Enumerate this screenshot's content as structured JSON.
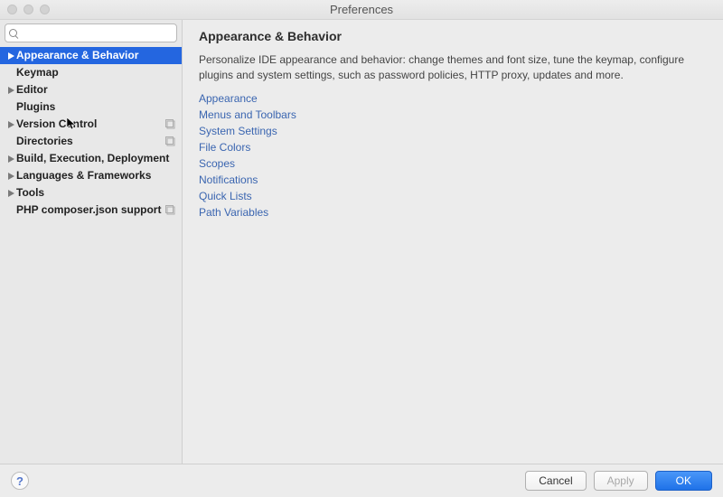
{
  "window": {
    "title": "Preferences"
  },
  "search": {
    "placeholder": ""
  },
  "sidebar": {
    "items": [
      {
        "label": "Appearance & Behavior",
        "expandable": true,
        "bold": true,
        "selected": true,
        "indent": 0,
        "projMarker": false
      },
      {
        "label": "Keymap",
        "expandable": false,
        "bold": true,
        "selected": false,
        "indent": 0,
        "projMarker": false
      },
      {
        "label": "Editor",
        "expandable": true,
        "bold": true,
        "selected": false,
        "indent": 0,
        "projMarker": false
      },
      {
        "label": "Plugins",
        "expandable": false,
        "bold": true,
        "selected": false,
        "indent": 0,
        "projMarker": false
      },
      {
        "label": "Version Control",
        "expandable": true,
        "bold": true,
        "selected": false,
        "indent": 0,
        "projMarker": true,
        "cursor": true
      },
      {
        "label": "Directories",
        "expandable": false,
        "bold": true,
        "selected": false,
        "indent": 0,
        "projMarker": true
      },
      {
        "label": "Build, Execution, Deployment",
        "expandable": true,
        "bold": true,
        "selected": false,
        "indent": 0,
        "projMarker": false
      },
      {
        "label": "Languages & Frameworks",
        "expandable": true,
        "bold": true,
        "selected": false,
        "indent": 0,
        "projMarker": false
      },
      {
        "label": "Tools",
        "expandable": true,
        "bold": true,
        "selected": false,
        "indent": 0,
        "projMarker": false
      },
      {
        "label": "PHP composer.json support",
        "expandable": false,
        "bold": true,
        "selected": false,
        "indent": 0,
        "projMarker": true
      }
    ]
  },
  "page": {
    "title": "Appearance & Behavior",
    "description": "Personalize IDE appearance and behavior: change themes and font size, tune the keymap, configure plugins and system settings, such as password policies, HTTP proxy, updates and more.",
    "links": [
      "Appearance",
      "Menus and Toolbars",
      "System Settings",
      "File Colors",
      "Scopes",
      "Notifications",
      "Quick Lists",
      "Path Variables"
    ]
  },
  "footer": {
    "cancel": "Cancel",
    "apply": "Apply",
    "ok": "OK"
  }
}
